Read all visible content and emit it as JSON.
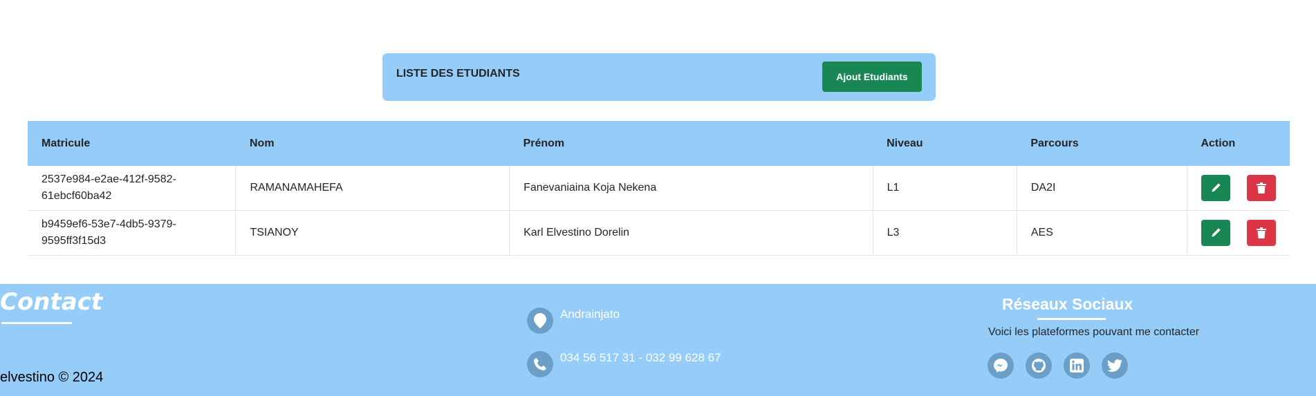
{
  "header": {
    "title": "LISTE DES ETUDIANTS",
    "add_label": "Ajout Etudiants"
  },
  "table": {
    "columns": [
      "Matricule",
      "Nom",
      "Prénom",
      "Niveau",
      "Parcours",
      "Action"
    ],
    "rows": [
      {
        "matricule": "2537e984-e2ae-412f-9582-61ebcf60ba42",
        "nom": "RAMANAMAHEFA",
        "prenom": "Fanevaniaina Koja Nekena",
        "niveau": "L1",
        "parcours": "DA2I"
      },
      {
        "matricule": "b9459ef6-53e7-4db5-9379-9595ff3f15d3",
        "nom": "TSIANOY",
        "prenom": "Karl Elvestino Dorelin",
        "niveau": "L3",
        "parcours": "AES"
      }
    ]
  },
  "footer": {
    "contact_title": "Contact",
    "copyright": "elvestino © 2024",
    "location": "Andrainjato",
    "phones": "034 56 517 31 - 032 99 628 67",
    "social_title": "Réseaux Sociaux",
    "social_desc": "Voici les plateformes pouvant me contacter",
    "social_icons": [
      "messenger-icon",
      "github-icon",
      "linkedin-icon",
      "twitter-icon"
    ]
  },
  "colors": {
    "accent": "#96ccf8",
    "success": "#198754",
    "danger": "#dc3545",
    "icon_circle": "#6b9fc7"
  }
}
